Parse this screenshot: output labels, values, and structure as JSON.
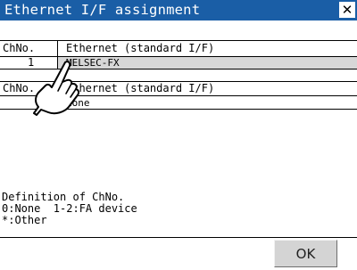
{
  "window": {
    "title": "Ethernet I/F assignment",
    "close_label": "✕",
    "colors": {
      "titlebar": "#1a5ea6",
      "selected_row": "#d7d7d7"
    }
  },
  "table1": {
    "col_header": "ChNo.",
    "name_header": "Ethernet (standard I/F)",
    "rows": [
      {
        "ch": "1",
        "value": "MELSEC-FX"
      }
    ]
  },
  "table2": {
    "col_header": "ChNo.",
    "name_header": "Ethernet (standard I/F)",
    "rows": [
      {
        "ch": "",
        "value": "None"
      }
    ]
  },
  "definition": {
    "heading": "Definition of ChNo.",
    "line1": "0:None  1-2:FA device",
    "line2": "*:Other"
  },
  "buttons": {
    "ok_label": "OK"
  },
  "cursor": {
    "icon": "touch-hand-icon"
  }
}
